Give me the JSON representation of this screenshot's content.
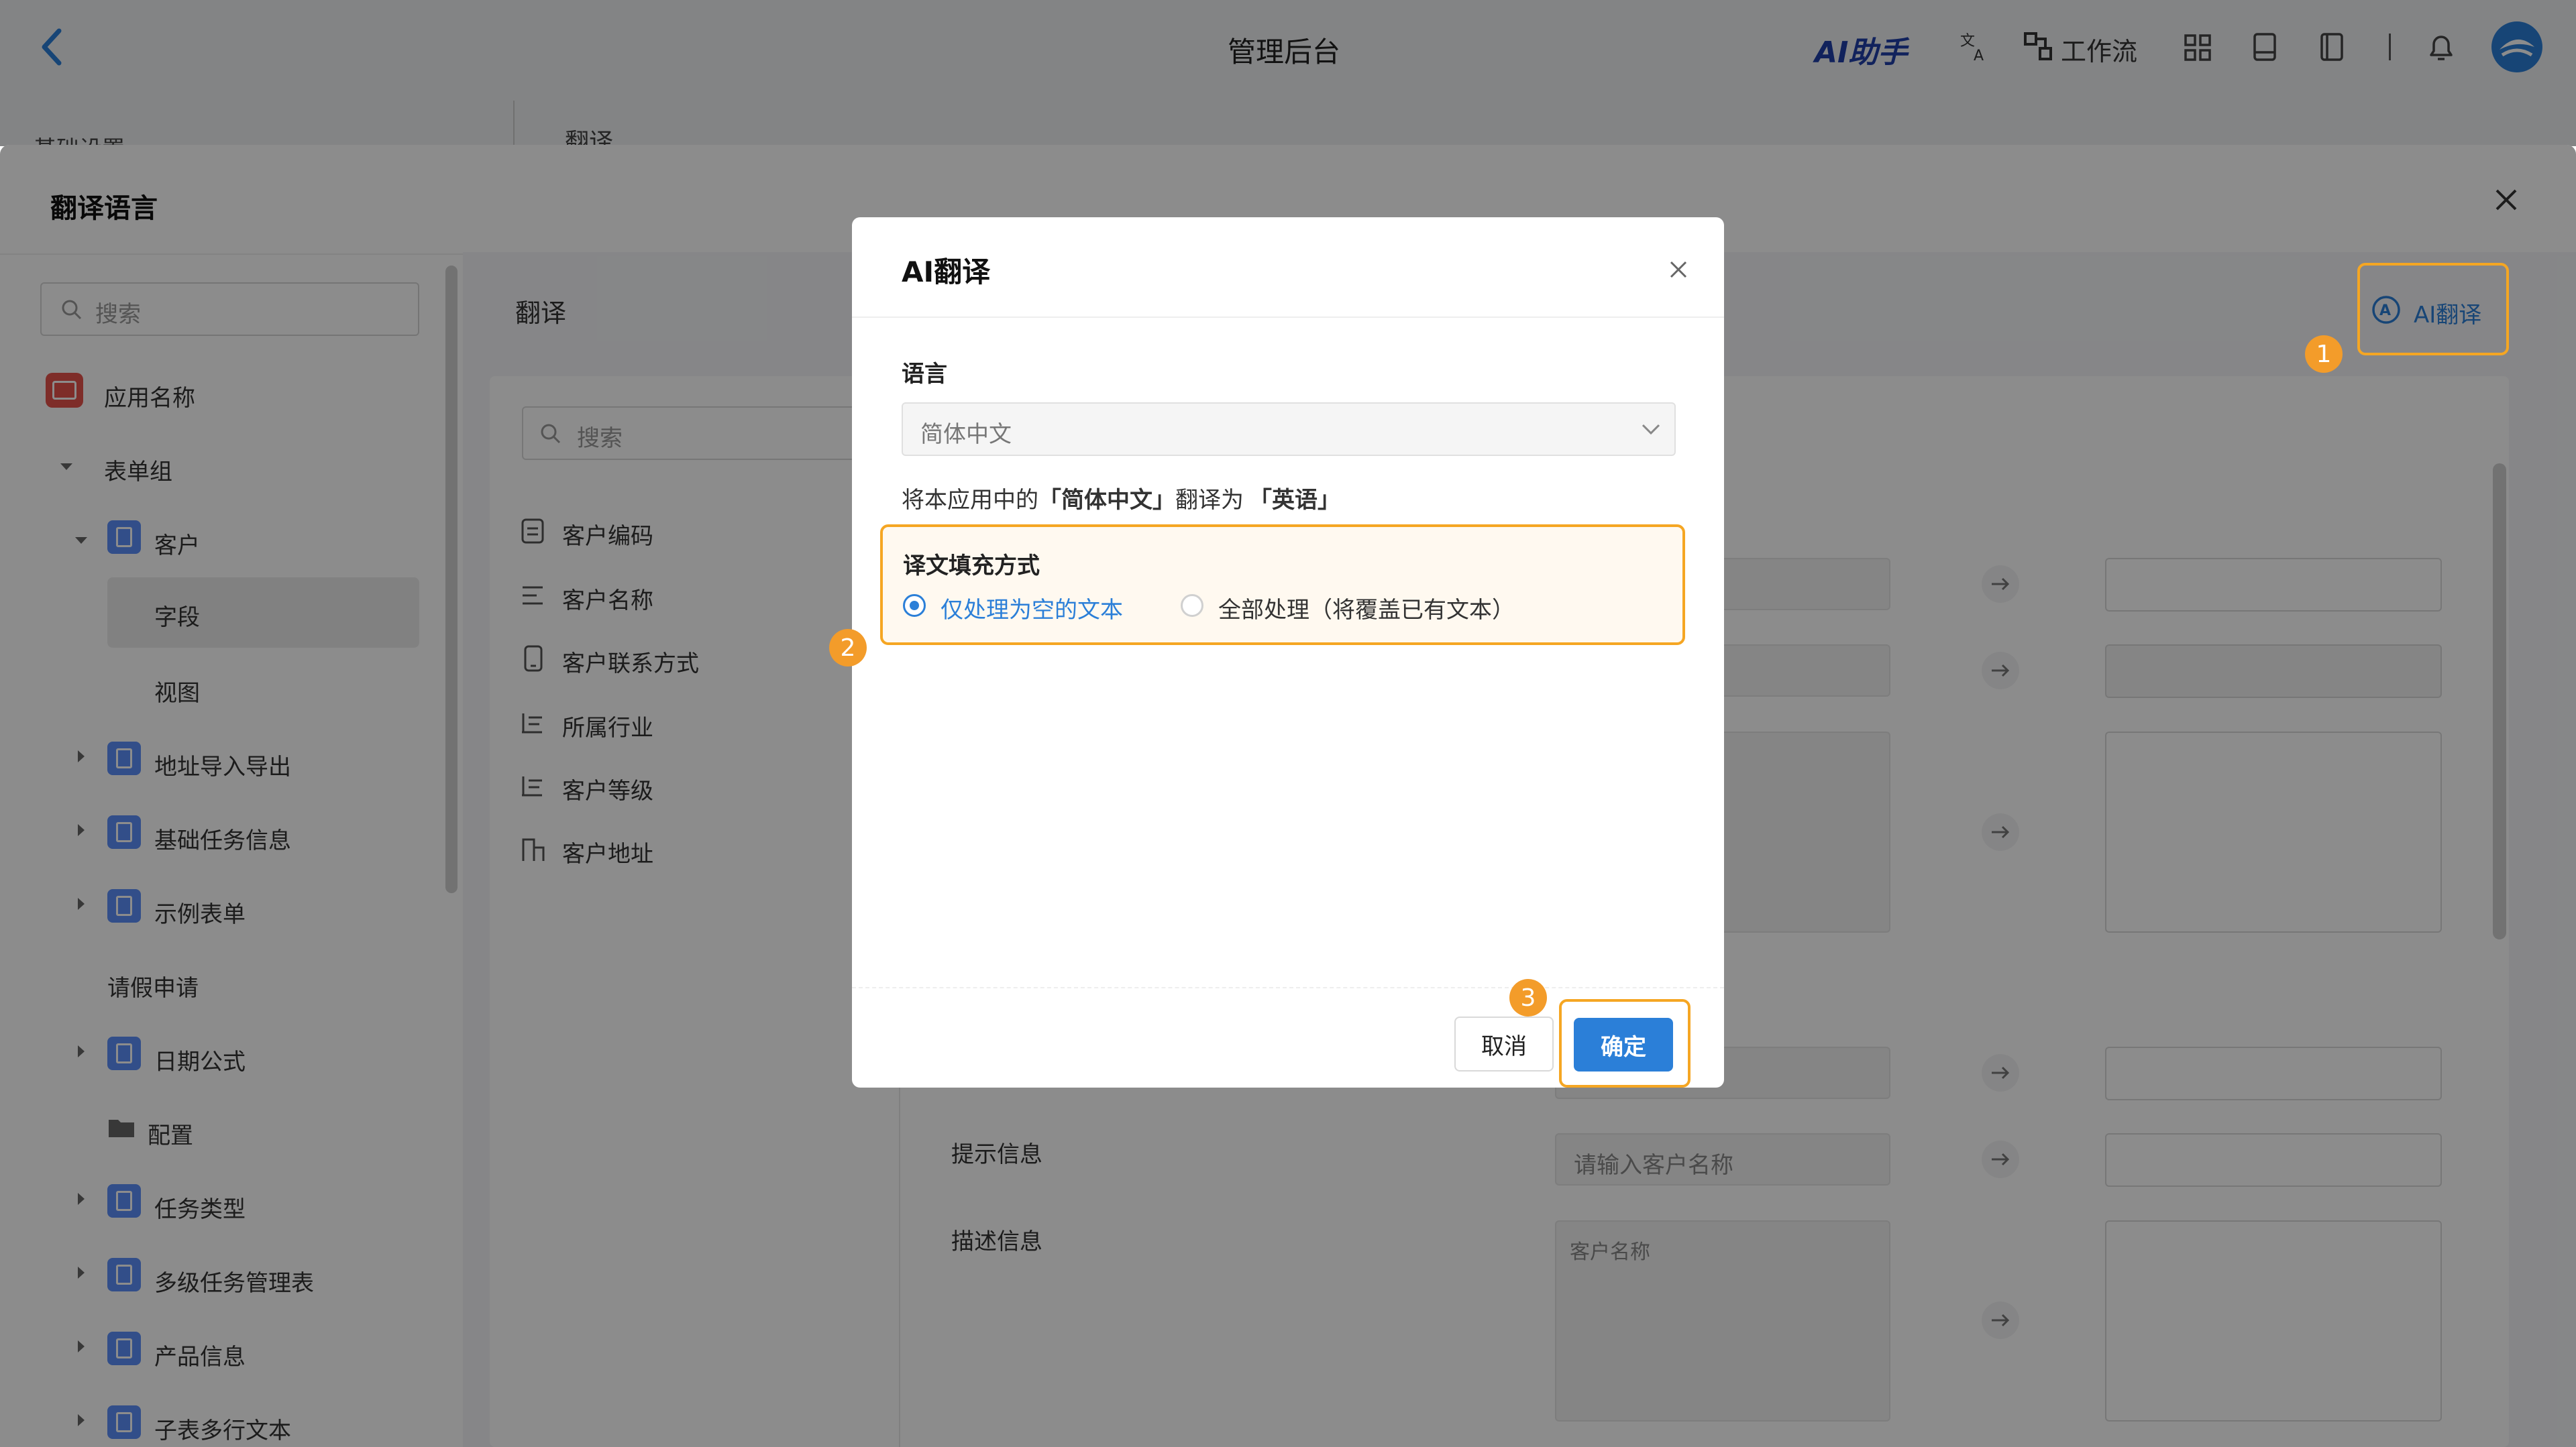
{
  "app": {
    "title": "管理后台",
    "ai_assistant": "AI助手",
    "workflow": "工作流"
  },
  "behind": {
    "tab_basic": "基础设置",
    "tab_translate": "翻译"
  },
  "drawer": {
    "title": "翻译语言",
    "search_placeholder": "搜索",
    "ai_translate_button": "AI翻译",
    "panel_title": "翻译",
    "field_search_placeholder": "搜索"
  },
  "sidebar": {
    "items": [
      {
        "label": "应用名称"
      },
      {
        "label": "表单组"
      },
      {
        "label": "客户"
      },
      {
        "label": "字段"
      },
      {
        "label": "视图"
      },
      {
        "label": "地址导入导出"
      },
      {
        "label": "基础任务信息"
      },
      {
        "label": "示例表单"
      },
      {
        "label": "请假申请"
      },
      {
        "label": "日期公式"
      },
      {
        "label": "配置"
      },
      {
        "label": "任务类型"
      },
      {
        "label": "多级任务管理表"
      },
      {
        "label": "产品信息"
      },
      {
        "label": "子表多行文本"
      }
    ]
  },
  "fields": {
    "items": [
      {
        "label": "客户编码"
      },
      {
        "label": "客户名称"
      },
      {
        "label": "客户联系方式"
      },
      {
        "label": "所属行业"
      },
      {
        "label": "客户等级"
      },
      {
        "label": "客户地址"
      }
    ]
  },
  "rows": {
    "hint_label": "提示信息",
    "hint_source": "请输入客户名称",
    "desc_label": "描述信息",
    "desc_source": "客户名称"
  },
  "dialog": {
    "title": "AI翻译",
    "language_label": "语言",
    "language_value": "简体中文",
    "note_prefix": "将本应用中的",
    "note_source": "「简体中文」",
    "note_mid": "翻译为",
    "note_target": "「英语」",
    "fill_label": "译文填充方式",
    "option_empty": "仅处理为空的文本",
    "option_all": "全部处理（将覆盖已有文本）",
    "cancel": "取消",
    "confirm": "确定"
  },
  "badges": [
    "1",
    "2",
    "3"
  ],
  "colors": {
    "accent": "#2b7fd8",
    "highlight": "#f5a623",
    "badge": "#f39c2a"
  }
}
